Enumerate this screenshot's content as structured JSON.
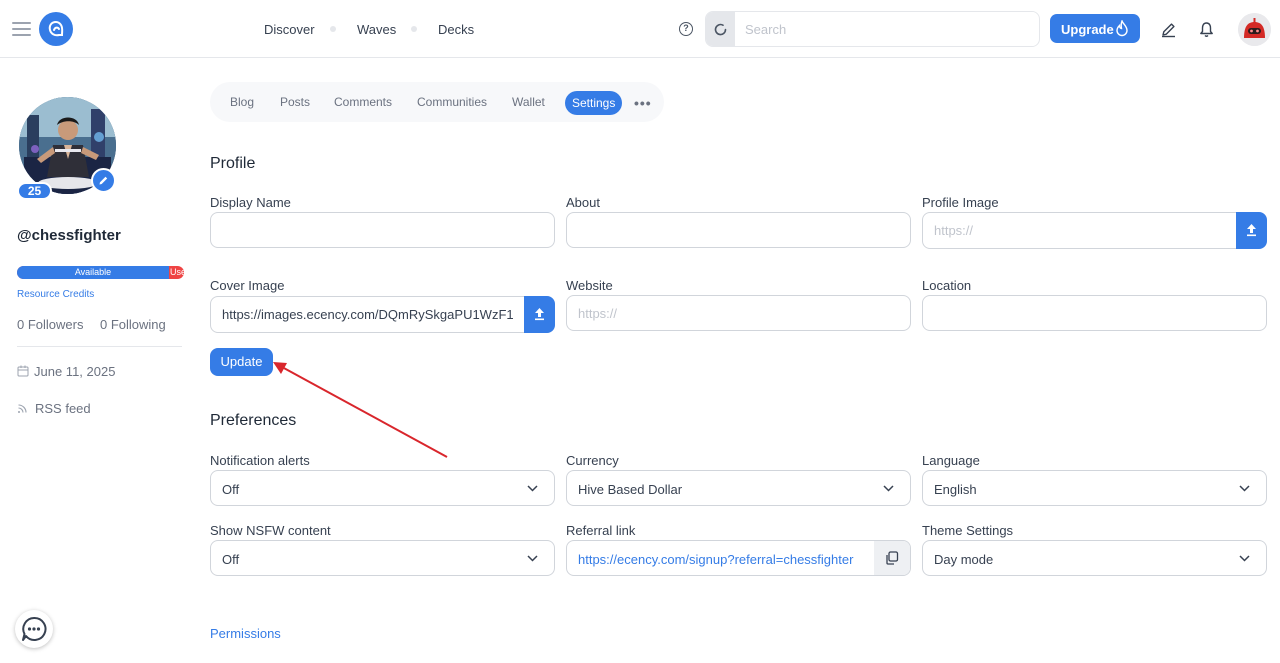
{
  "header": {
    "nav": [
      "Discover",
      "Waves",
      "Decks"
    ],
    "search_placeholder": "Search",
    "upgrade_label": "Upgrade"
  },
  "sidebar": {
    "reputation": "25",
    "username": "@chessfighter",
    "rc_available": "Available",
    "rc_used": "Use",
    "rc_link": "Resource Credits",
    "followers": "0 Followers",
    "following": "0 Following",
    "joined": "June 11, 2025",
    "rss": "RSS feed"
  },
  "tabs": [
    "Blog",
    "Posts",
    "Comments",
    "Communities",
    "Wallet",
    "Settings"
  ],
  "tabs_more": "•••",
  "profile": {
    "title": "Profile",
    "display_name_label": "Display Name",
    "about_label": "About",
    "profile_image_label": "Profile Image",
    "profile_image_placeholder": "https://",
    "cover_image_label": "Cover Image",
    "cover_image_value": "https://images.ecency.com/DQmRySkgaPU1WzF1",
    "website_label": "Website",
    "website_placeholder": "https://",
    "location_label": "Location",
    "update_label": "Update"
  },
  "preferences": {
    "title": "Preferences",
    "notification_label": "Notification alerts",
    "notification_value": "Off",
    "currency_label": "Currency",
    "currency_value": "Hive Based Dollar",
    "language_label": "Language",
    "language_value": "English",
    "nsfw_label": "Show NSFW content",
    "nsfw_value": "Off",
    "referral_label": "Referral link",
    "referral_value": "https://ecency.com/signup?referral=chessfighter",
    "theme_label": "Theme Settings",
    "theme_value": "Day mode"
  },
  "permissions_label": "Permissions",
  "colors": {
    "accent": "#357ce6",
    "annotation_arrow": "#d9262c"
  }
}
